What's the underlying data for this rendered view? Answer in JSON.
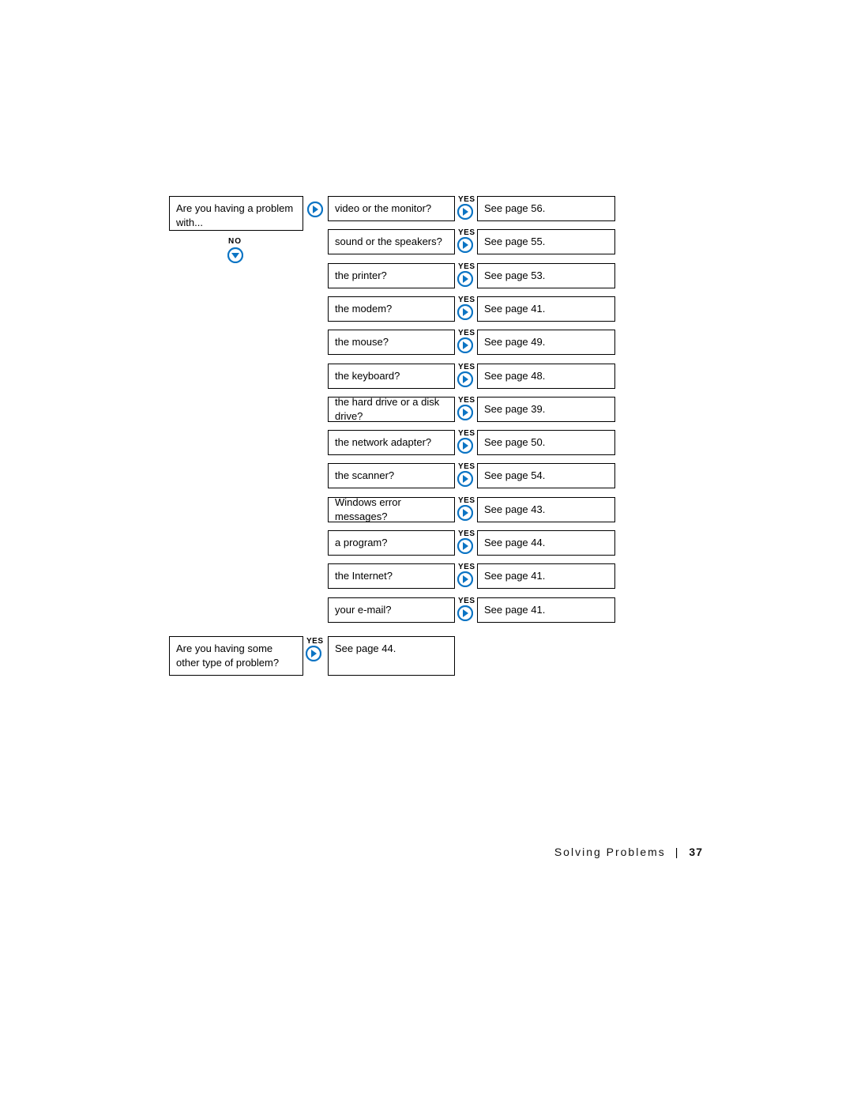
{
  "leftBox": {
    "text": "Are you having a problem with..."
  },
  "noLabel": "NO",
  "yesLabel": "YES",
  "rows": [
    {
      "question": "video or the monitor?",
      "answer": "See page 56."
    },
    {
      "question": "sound or the speakers?",
      "answer": "See page 55."
    },
    {
      "question": "the printer?",
      "answer": "See page 53."
    },
    {
      "question": "the modem?",
      "answer": "See page 41."
    },
    {
      "question": "the mouse?",
      "answer": "See page 49."
    },
    {
      "question": "the keyboard?",
      "answer": "See page 48."
    },
    {
      "question": "the hard drive or a disk drive?",
      "answer": "See page 39."
    },
    {
      "question": "the network adapter?",
      "answer": "See page 50."
    },
    {
      "question": "the scanner?",
      "answer": "See page 54."
    },
    {
      "question": "Windows error messages?",
      "answer": "See page 43."
    },
    {
      "question": "a program?",
      "answer": "See page 44."
    },
    {
      "question": "the Internet?",
      "answer": "See page 41."
    },
    {
      "question": "your e-mail?",
      "answer": "See page 41."
    }
  ],
  "bottomLeft": {
    "text": "Are you having some other type of problem?"
  },
  "bottomRight": {
    "text": "See page 44."
  },
  "footer": {
    "section": "Solving Problems",
    "page": "37"
  },
  "layout": {
    "firstRowTop": 248,
    "rowStep": 42.3,
    "qLeft": 415,
    "qWidth": 161,
    "qHeight": 32,
    "aLeft": 604,
    "aWidth": 175,
    "aHeight": 32,
    "yesX": 580
  },
  "colors": {
    "iconBlue": "#0b74c4"
  }
}
